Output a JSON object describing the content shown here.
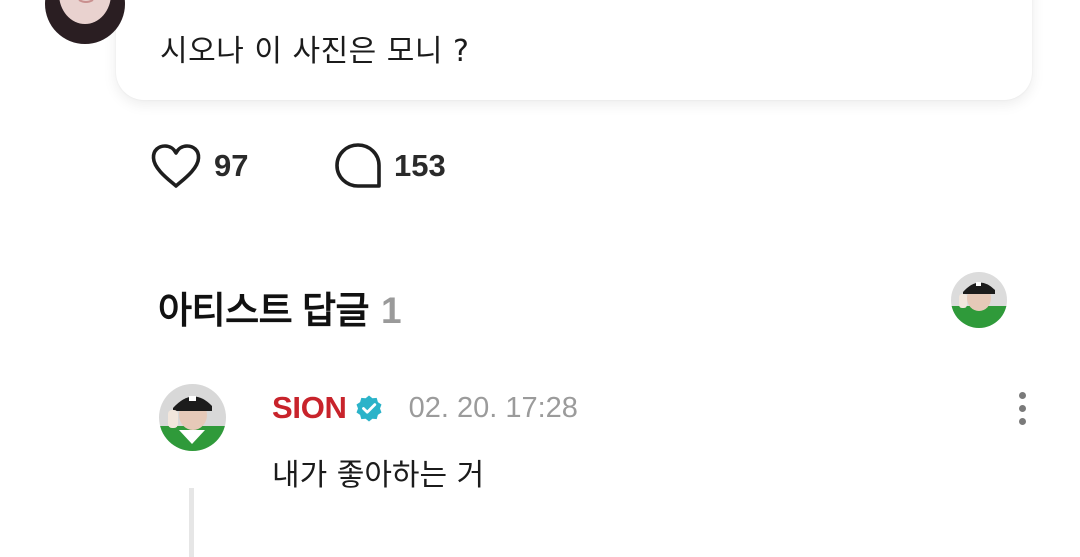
{
  "post": {
    "text": "시오나 이 사진은 모니 ?",
    "likes_count": "97",
    "comments_count": "153",
    "like_icon": "heart-outline-icon",
    "comment_icon": "speech-bubble-icon"
  },
  "artist_replies": {
    "title": "아티스트 답글",
    "count": "1"
  },
  "reply": {
    "author": "SION",
    "verified_icon": "verified-badge-icon",
    "date": "02. 20. 17:28",
    "text": "내가 좋아하는 거",
    "more_icon": "more-vertical-icon"
  },
  "colors": {
    "author": "#c8232b",
    "verified": "#2bb3c9",
    "muted": "#9b9b9b"
  }
}
